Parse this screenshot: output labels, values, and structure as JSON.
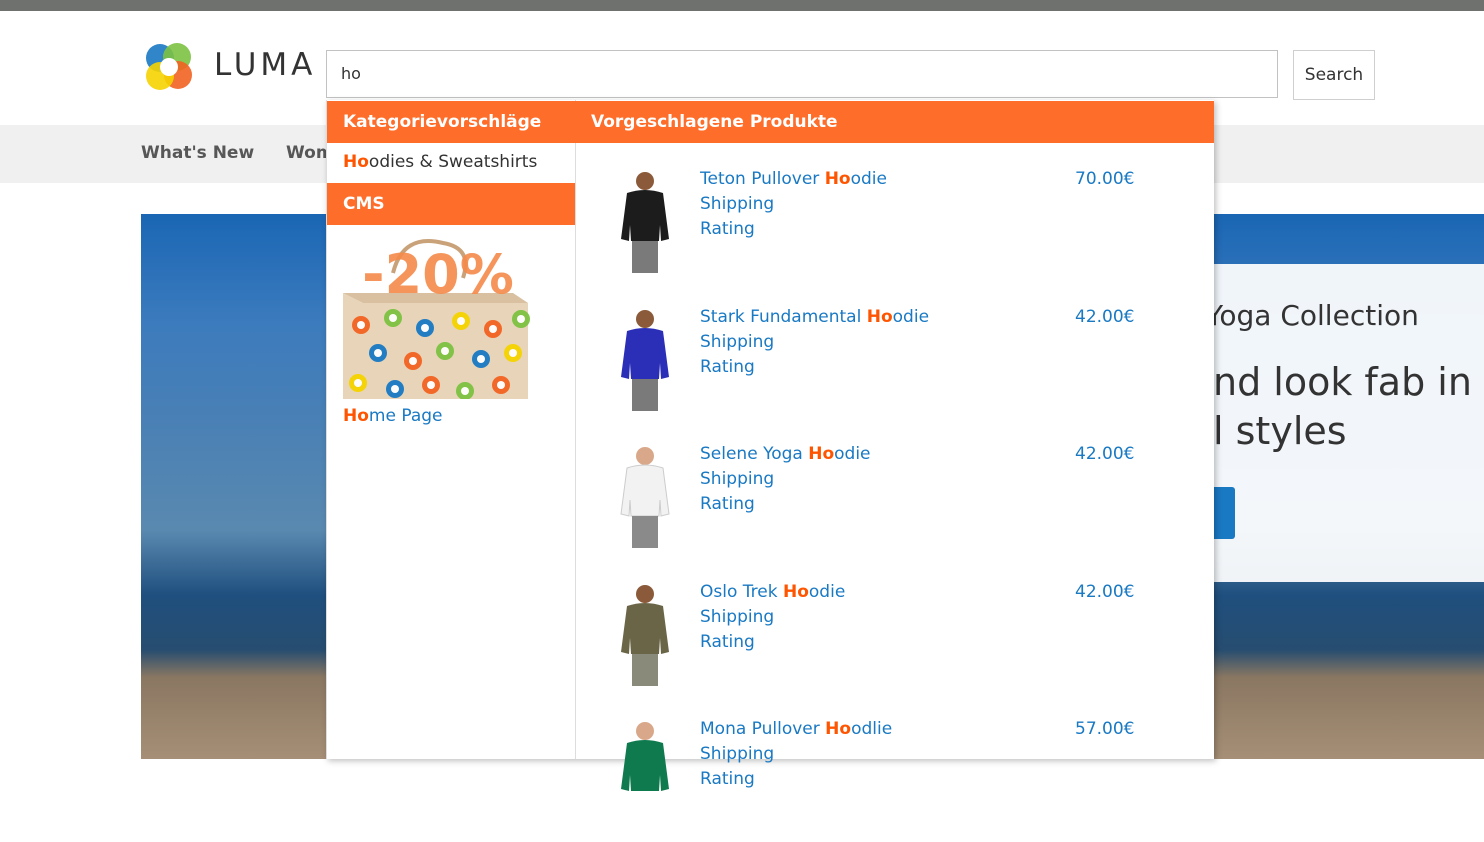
{
  "header": {
    "logo_text": "LUMA",
    "search": {
      "value": "ho",
      "button_label": "Search"
    }
  },
  "nav": {
    "items": [
      {
        "label": "What's New"
      },
      {
        "label": "Wom"
      }
    ]
  },
  "hero": {
    "subtitle": "Yoga Collection",
    "title_line1": "nd look fab in n",
    "title_line2": "l styles"
  },
  "autocomplete": {
    "highlight": "Ho",
    "categories": {
      "header": "Kategorievorschläge",
      "items": [
        {
          "highlight": "Ho",
          "rest": "odies & Sweatshirts"
        }
      ]
    },
    "cms": {
      "header": "CMS",
      "image_label": "-20%",
      "link": {
        "highlight": "Ho",
        "rest": "me Page"
      }
    },
    "products": {
      "header": "Vorgeschlagene Produkte",
      "items": [
        {
          "name_before": "Teton Pullover ",
          "name_highlight": "Ho",
          "name_after": "odie",
          "shipping": "Shipping",
          "rating": "Rating",
          "price": "70.00€",
          "shirt_color": "#1c1c1c"
        },
        {
          "name_before": "Stark Fundamental ",
          "name_highlight": "Ho",
          "name_after": "odie",
          "shipping": "Shipping",
          "rating": "Rating",
          "price": "42.00€",
          "shirt_color": "#2b2fb8"
        },
        {
          "name_before": "Selene Yoga ",
          "name_highlight": "Ho",
          "name_after": "odie",
          "shipping": "Shipping",
          "rating": "Rating",
          "price": "42.00€",
          "shirt_color": "#f2f2f2"
        },
        {
          "name_before": "Oslo Trek ",
          "name_highlight": "Ho",
          "name_after": "odie",
          "shipping": "Shipping",
          "rating": "Rating",
          "price": "42.00€",
          "shirt_color": "#6b6548"
        },
        {
          "name_before": "Mona Pullover ",
          "name_highlight": "Ho",
          "name_after": "odlie",
          "shipping": "Shipping",
          "rating": "Rating",
          "price": "57.00€",
          "shirt_color": "#0f7a4e"
        }
      ]
    }
  },
  "colors": {
    "accent": "#ff6d2a",
    "link": "#1979c3",
    "highlight": "#ff5501"
  }
}
